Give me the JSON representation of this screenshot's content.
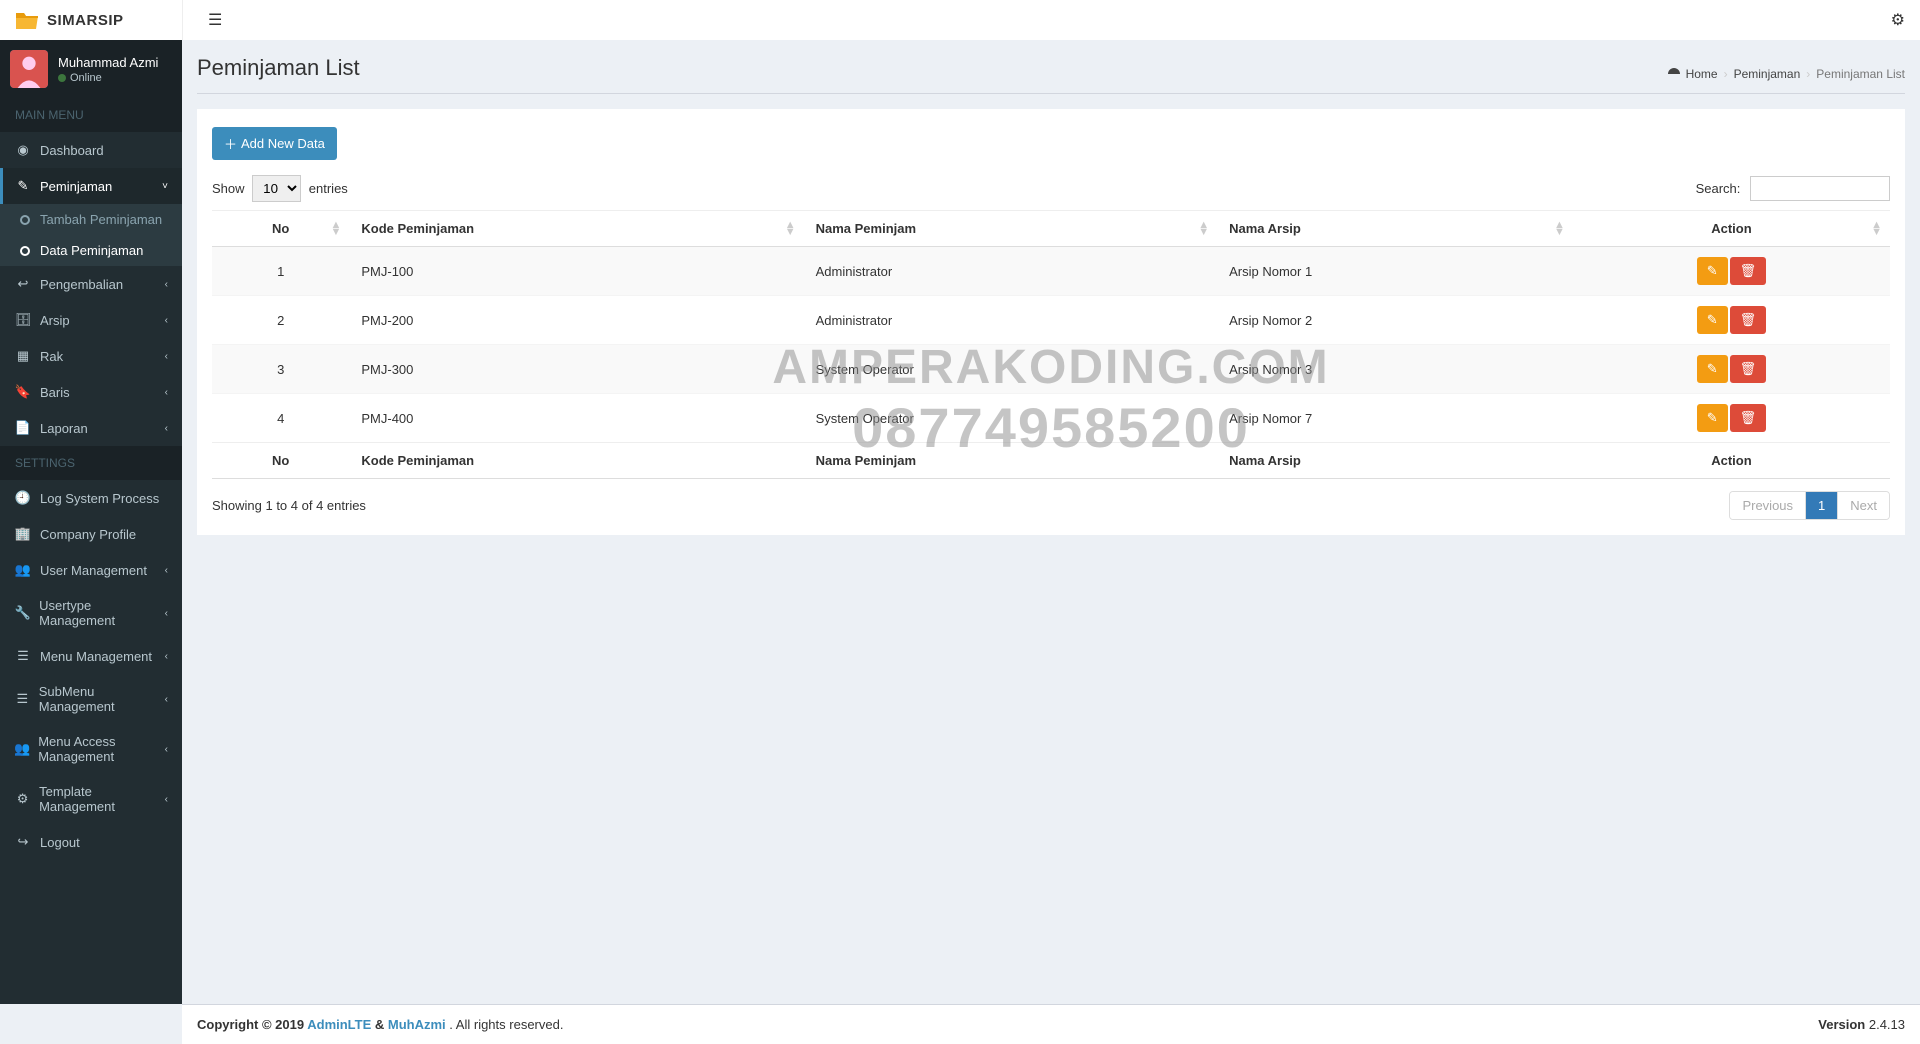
{
  "brand": "SIMARSIP",
  "user": {
    "name": "Muhammad Azmi",
    "status": "Online"
  },
  "sidebar": {
    "header_main": "MAIN MENU",
    "header_settings": "SETTINGS",
    "items_main": [
      {
        "label": "Dashboard"
      },
      {
        "label": "Peminjaman",
        "caret": "˅",
        "children": [
          {
            "label": "Tambah Peminjaman"
          },
          {
            "label": "Data Peminjaman"
          }
        ]
      },
      {
        "label": "Pengembalian",
        "caret": "‹"
      },
      {
        "label": "Arsip",
        "caret": "‹"
      },
      {
        "label": "Rak",
        "caret": "‹"
      },
      {
        "label": "Baris",
        "caret": "‹"
      },
      {
        "label": "Laporan",
        "caret": "‹"
      }
    ],
    "items_settings": [
      {
        "label": "Log System Process"
      },
      {
        "label": "Company Profile"
      },
      {
        "label": "User Management",
        "caret": "‹"
      },
      {
        "label": "Usertype Management",
        "caret": "‹"
      },
      {
        "label": "Menu Management",
        "caret": "‹"
      },
      {
        "label": "SubMenu Management",
        "caret": "‹"
      },
      {
        "label": "Menu Access Management",
        "caret": "‹"
      },
      {
        "label": "Template Management",
        "caret": "‹"
      },
      {
        "label": "Logout"
      }
    ]
  },
  "page": {
    "title": "Peminjaman List",
    "breadcrumb": {
      "home": "Home",
      "parent": "Peminjaman",
      "current": "Peminjaman List"
    },
    "add_button": "Add New Data"
  },
  "datatable": {
    "show_label_pre": "Show",
    "show_label_post": "entries",
    "length_value": "10",
    "search_label": "Search:",
    "columns": [
      "No",
      "Kode Peminjaman",
      "Nama Peminjam",
      "Nama Arsip",
      "Action"
    ],
    "rows": [
      {
        "no": "1",
        "kode": "PMJ-100",
        "nama": "Administrator",
        "arsip": "Arsip Nomor 1"
      },
      {
        "no": "2",
        "kode": "PMJ-200",
        "nama": "Administrator",
        "arsip": "Arsip Nomor 2"
      },
      {
        "no": "3",
        "kode": "PMJ-300",
        "nama": "System Operator",
        "arsip": "Arsip Nomor 3"
      },
      {
        "no": "4",
        "kode": "PMJ-400",
        "nama": "System Operator",
        "arsip": "Arsip Nomor 7"
      }
    ],
    "info": "Showing 1 to 4 of 4 entries",
    "pagination": {
      "prev": "Previous",
      "page": "1",
      "next": "Next"
    }
  },
  "watermark": {
    "line1": "AMPERAKODING.COM",
    "line2": "087749585200"
  },
  "footer": {
    "copyright_pre": "Copyright © 2019 ",
    "link1": "AdminLTE",
    "amp": " & ",
    "link2": "MuhAzmi",
    "copyright_post": ". All rights reserved.",
    "version_label": "Version",
    "version_value": " 2.4.13"
  }
}
